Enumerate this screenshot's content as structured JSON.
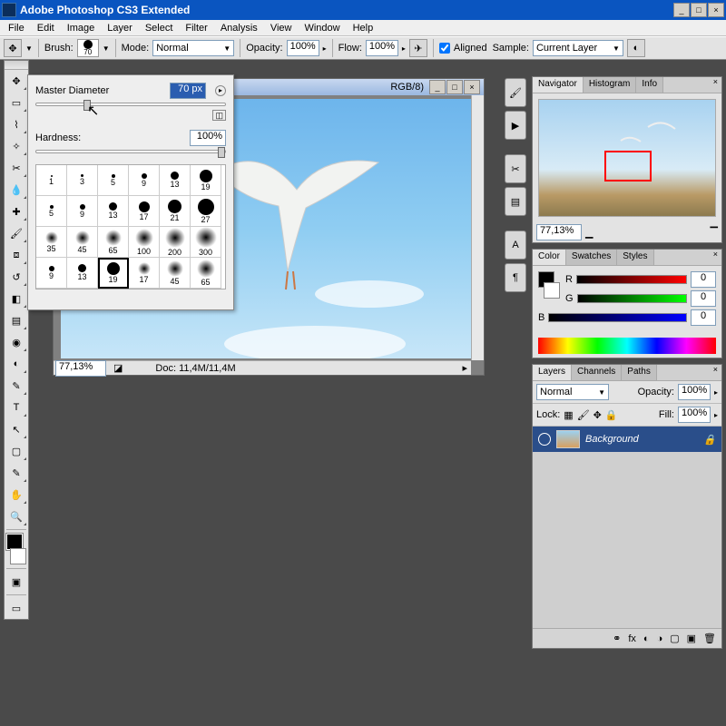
{
  "app": {
    "title": "Adobe Photoshop CS3 Extended"
  },
  "menu": {
    "items": [
      "File",
      "Edit",
      "Image",
      "Layer",
      "Select",
      "Filter",
      "Analysis",
      "View",
      "Window",
      "Help"
    ]
  },
  "options": {
    "brush_label": "Brush:",
    "brush_size": "70",
    "mode_label": "Mode:",
    "mode_value": "Normal",
    "opacity_label": "Opacity:",
    "opacity_value": "100%",
    "flow_label": "Flow:",
    "flow_value": "100%",
    "aligned_label": "Aligned",
    "sample_label": "Sample:",
    "sample_value": "Current Layer"
  },
  "brushpanel": {
    "master_label": "Master Diameter",
    "master_value": "70 px",
    "hardness_label": "Hardness:",
    "hardness_value": "100%",
    "presets": [
      {
        "s": 1,
        "sz": 2,
        "soft": false
      },
      {
        "s": 3,
        "sz": 3,
        "soft": false
      },
      {
        "s": 5,
        "sz": 4,
        "soft": false
      },
      {
        "s": 9,
        "sz": 6,
        "soft": false
      },
      {
        "s": 13,
        "sz": 9,
        "soft": false
      },
      {
        "s": 19,
        "sz": 14,
        "soft": false
      },
      {
        "s": 5,
        "sz": 4,
        "soft": false
      },
      {
        "s": 9,
        "sz": 6,
        "soft": false
      },
      {
        "s": 13,
        "sz": 9,
        "soft": false
      },
      {
        "s": 17,
        "sz": 12,
        "soft": false
      },
      {
        "s": 21,
        "sz": 15,
        "soft": false
      },
      {
        "s": 27,
        "sz": 18,
        "soft": false
      },
      {
        "s": 35,
        "sz": 14,
        "soft": true
      },
      {
        "s": 45,
        "sz": 16,
        "soft": true
      },
      {
        "s": 65,
        "sz": 18,
        "soft": true
      },
      {
        "s": 100,
        "sz": 20,
        "soft": true
      },
      {
        "s": 200,
        "sz": 22,
        "soft": true
      },
      {
        "s": 300,
        "sz": 24,
        "soft": true
      },
      {
        "s": 9,
        "sz": 6,
        "soft": false
      },
      {
        "s": 13,
        "sz": 9,
        "soft": false
      },
      {
        "s": 19,
        "sz": 14,
        "soft": false,
        "sel": true
      },
      {
        "s": 17,
        "sz": 14,
        "soft": true
      },
      {
        "s": 45,
        "sz": 18,
        "soft": true
      },
      {
        "s": 65,
        "sz": 20,
        "soft": true
      }
    ]
  },
  "document": {
    "title_suffix": "RGB/8)",
    "zoom": "77,13%",
    "doc_size": "Doc: 11,4M/11,4M"
  },
  "navigator": {
    "tabs": [
      "Navigator",
      "Histogram",
      "Info"
    ],
    "zoom": "77,13%"
  },
  "color": {
    "tabs": [
      "Color",
      "Swatches",
      "Styles"
    ],
    "channels": [
      {
        "l": "R",
        "v": "0"
      },
      {
        "l": "G",
        "v": "0"
      },
      {
        "l": "B",
        "v": "0"
      }
    ]
  },
  "layers": {
    "tabs": [
      "Layers",
      "Channels",
      "Paths"
    ],
    "blend": "Normal",
    "opacity_label": "Opacity:",
    "opacity": "100%",
    "lock_label": "Lock:",
    "fill_label": "Fill:",
    "fill": "100%",
    "items": [
      {
        "name": "Background"
      }
    ]
  }
}
